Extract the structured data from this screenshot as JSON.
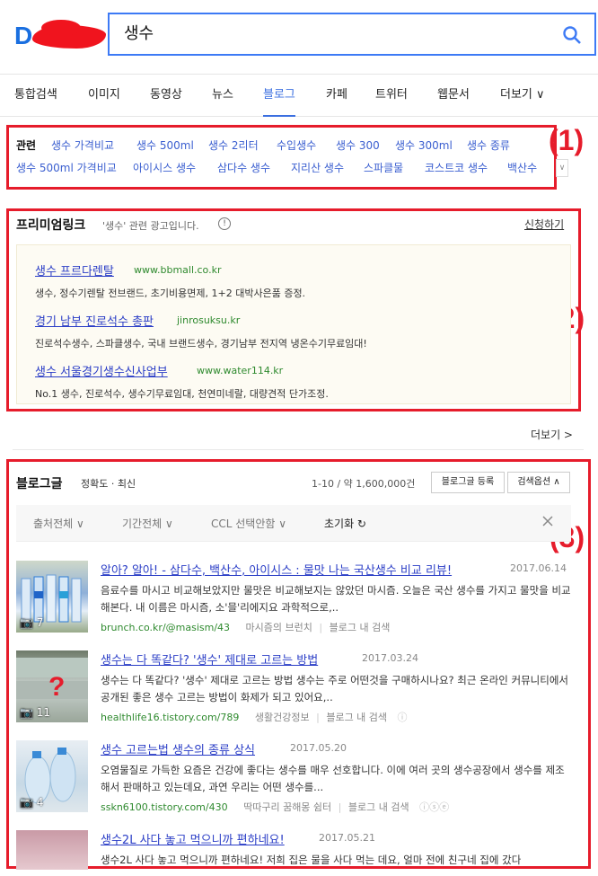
{
  "search": {
    "query": "생수"
  },
  "tabs": [
    {
      "label": "통합검색"
    },
    {
      "label": "이미지"
    },
    {
      "label": "동영상"
    },
    {
      "label": "뉴스"
    },
    {
      "label": "블로그"
    },
    {
      "label": "카페"
    },
    {
      "label": "트위터"
    },
    {
      "label": "웹문서"
    },
    {
      "label": "더보기 ∨"
    }
  ],
  "annotations": {
    "n1": "(1)",
    "n2": "(2)",
    "n3": "(3)"
  },
  "related": {
    "title": "관련",
    "row1": [
      "생수 가격비교",
      "생수 500ml",
      "생수 2리터",
      "수입생수",
      "생수 300",
      "생수 300ml",
      "생수 종류"
    ],
    "row2": [
      "생수 500ml 가격비교",
      "아이시스 생수",
      "삼다수 생수",
      "지리산 생수",
      "스파클물",
      "코스트코 생수",
      "백산수"
    ]
  },
  "premium": {
    "title": "프리미엄링크",
    "subtitle": "'생수' 관련 광고입니다.",
    "apply": "신청하기",
    "ads": [
      {
        "title": "생수 프르다렌탈",
        "url": "www.bbmall.co.kr",
        "desc": "생수, 정수기렌탈 전브랜드, 초기비용면제, 1+2 대박사은품 증정."
      },
      {
        "title": "경기 남부 진로석수 총판",
        "url": "jinrosuksu.kr",
        "desc": "진로석수생수, 스파클생수, 국내 브랜드생수, 경기남부 전지역 냉온수기무료임대!"
      },
      {
        "title": "생수 서울경기생수신사업부",
        "url": "www.water114.kr",
        "desc": "No.1 생수, 진로석수, 생수기무료임대, 천연미네랄, 대량견적 단가조정."
      }
    ],
    "more": "더보기 >"
  },
  "blog": {
    "title": "블로그글",
    "sort": "정확도 · 최신",
    "count": "1-10 / 약 1,600,000건",
    "register": "블로그글 등록",
    "options": "검색옵션 ∧",
    "filters": [
      "출처전체 ∨",
      "기간전체 ∨",
      "CCL 선택안함 ∨",
      "초기화 ↻"
    ],
    "results": [
      {
        "title": "알아? 알아! - 삼다수, 백산수, 아이시스 : 물맛 나는 국산생수 비교 리뷰!",
        "date": "2017.06.14",
        "desc": "음료수를 마시고 비교해보았지만 물맛은 비교해보지는 않았던 마시즘. 오늘은 국산 생수를 가지고 물맛을 비교해본다. 내 이름은 마시즘, 소'믈'리에지요 과학적으로,..",
        "source": "brunch.co.kr/@masism/43",
        "blog": "마시즘의 브런치",
        "action": "블로그 내 검색",
        "photos": "7"
      },
      {
        "title": "생수는 다 똑같다? '생수' 제대로 고르는 방법",
        "date": "2017.03.24",
        "desc": "생수는 다 똑같다? '생수' 제대로 고르는 방법 생수는 주로 어떤것을 구매하시나요? 최근 온라인 커뮤니티에서 공개된 좋은 생수 고르는 방법이 화제가 되고 있어요,..",
        "source": "healthlife16.tistory.com/789",
        "blog": "생활건강정보",
        "action": "블로그 내 검색",
        "photos": "11"
      },
      {
        "title": "생수 고르는법 생수의 종류 상식",
        "date": "2017.05.20",
        "desc": "오염물질로 가득한 요즘은 건강에 좋다는 생수를 매우 선호합니다. 이에 여러 곳의 생수공장에서 생수를 제조해서 판매하고 있는데요, 과연 우리는 어떤 생수를...",
        "source": "sskn6100.tistory.com/430",
        "blog": "딱따구리 꿈해몽 쉼터",
        "action": "블로그 내 검색",
        "photos": "4"
      },
      {
        "title": "생수2L 사다 놓고 먹으니까 편하네요!",
        "date": "2017.05.21",
        "desc": "생수2L 사다 놓고 먹으니까 편하네요! 저희 집은 물을 사다 먹는 데요, 얼마 전에 친구네 집에 갔다",
        "source": "",
        "blog": "",
        "action": "",
        "photos": ""
      }
    ]
  },
  "colors": {
    "accent": "#3b6fe0",
    "annotation": "#e61c2b",
    "link": "#2a3dc6",
    "url": "#2f8a2f"
  }
}
